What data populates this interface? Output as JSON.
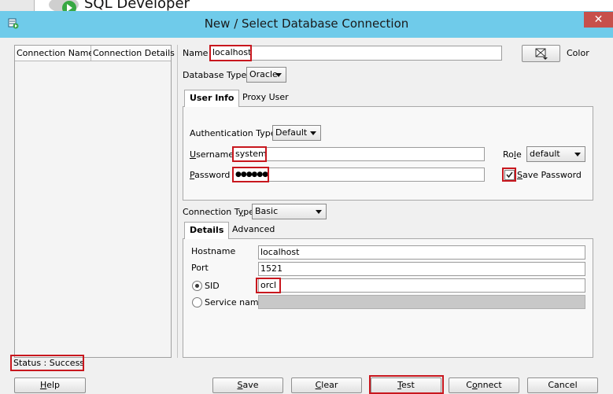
{
  "background_app": {
    "title": "SQL Developer"
  },
  "window": {
    "title": "New / Select Database Connection",
    "close_glyph": "✕"
  },
  "connections_table": {
    "columns": [
      "Connection Name",
      "Connection Details"
    ],
    "rows": []
  },
  "form": {
    "name_label": "Name",
    "name_value": "localhost",
    "color_label": "Color",
    "database_type_label": "Database Type",
    "database_type_value": "Oracle",
    "tabs": [
      "User Info",
      "Proxy User"
    ],
    "active_tab": "User Info",
    "auth_type_label": "Authentication Type",
    "auth_type_value": "Default",
    "username_label": "Username",
    "username_value": "system",
    "password_label": "Password",
    "password_value": "●●●●●●",
    "role_label": "Role",
    "role_value": "default",
    "save_password_label": "Save Password",
    "save_password_checked": true,
    "connection_type_label": "Connection Type",
    "connection_type_value": "Basic",
    "conn_tabs": [
      "Details",
      "Advanced"
    ],
    "active_conn_tab": "Details",
    "hostname_label": "Hostname",
    "hostname_value": "localhost",
    "port_label": "Port",
    "port_value": "1521",
    "sid_label": "SID",
    "sid_value": "orcl",
    "sid_selected": true,
    "service_name_label": "Service name",
    "service_name_value": ""
  },
  "status": {
    "text": "Status : Success"
  },
  "buttons": {
    "help": "Help",
    "save": "Save",
    "clear": "Clear",
    "test": "Test",
    "connect": "Connect",
    "cancel": "Cancel"
  },
  "colors": {
    "titlebar": "#6fcbea",
    "highlight": "#c8171e",
    "close": "#c7504b"
  }
}
